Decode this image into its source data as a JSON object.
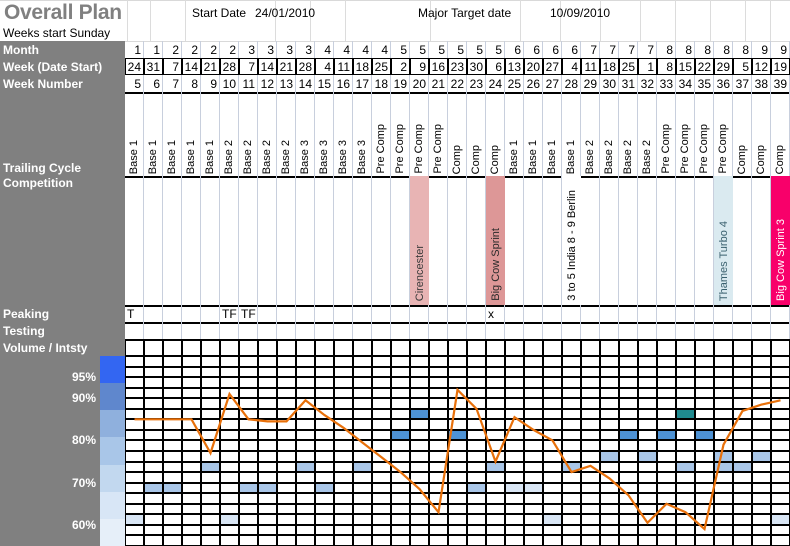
{
  "title": "Overall Plan",
  "subtitle": "Weeks start Sunday",
  "meta": {
    "start_date_label": "Start Date",
    "start_date_value": "24/01/2010",
    "target_date_label": "Major Target date",
    "target_date_value": "10/09/2010"
  },
  "row_labels": {
    "month": "Month",
    "week_date_start": "Week (Date Start)",
    "week_number": "Week Number",
    "training_cycle": "Trailing Cycle",
    "competition": "Competition",
    "peaking": "Peaking",
    "testing": "Testing",
    "volume": "Volume / Intsty"
  },
  "columns": {
    "month": [
      1,
      1,
      2,
      2,
      2,
      2,
      3,
      3,
      3,
      3,
      4,
      4,
      4,
      4,
      5,
      5,
      5,
      5,
      5,
      5,
      6,
      6,
      6,
      6,
      7,
      7,
      7,
      7,
      8,
      8,
      8,
      8,
      8,
      9,
      9,
      9
    ],
    "week_start": [
      24,
      31,
      7,
      14,
      21,
      28,
      7,
      14,
      21,
      28,
      4,
      11,
      18,
      25,
      2,
      9,
      16,
      23,
      30,
      6,
      13,
      20,
      27,
      4,
      11,
      18,
      25,
      1,
      8,
      15,
      22,
      29,
      5,
      12,
      19
    ],
    "week_number": [
      5,
      6,
      7,
      8,
      9,
      10,
      11,
      12,
      13,
      14,
      15,
      16,
      17,
      18,
      19,
      20,
      21,
      22,
      23,
      24,
      25,
      26,
      27,
      28,
      29,
      30,
      31,
      32,
      33,
      34,
      35,
      36,
      37,
      38,
      39
    ],
    "cycle": [
      "Base 1",
      "Base 1",
      "Base 1",
      "Base 1",
      "Base 1",
      "Base 2",
      "Base 2",
      "Base 2",
      "Base 2",
      "Base 3",
      "Base 3",
      "Base 3",
      "Base 3",
      "Pre Comp",
      "Pre Comp",
      "Pre Comp",
      "Pre Comp",
      "Comp",
      "Comp",
      "Comp",
      "Base 1",
      "Base 1",
      "Base 1",
      "Base 1",
      "Base 2",
      "Base 2",
      "Base 2",
      "Base 2",
      "Pre Comp",
      "Pre Comp",
      "Pre Comp",
      "Pre Comp",
      "Comp",
      "Comp",
      "Comp"
    ]
  },
  "competitions": [
    {
      "week": 20,
      "label": "Cirencester",
      "color": "#e8b4b4",
      "text_color": "#3a3a3a"
    },
    {
      "week": 24,
      "label": "Big Cow Sprint",
      "color": "#dd9797",
      "text_color": "#2b2b2b"
    },
    {
      "week": 28,
      "label": "3 to 5 India 8 - 9 Berlin",
      "color": "#ffffff",
      "text_color": "#000000"
    },
    {
      "week": 36,
      "label": "Thames Turbo 4",
      "color": "#daeaf0",
      "text_color": "#39606e"
    },
    {
      "week": 39,
      "label": "Big Cow Sprint 3",
      "color": "#f8006a",
      "text_color": "#ffffff"
    }
  ],
  "peaking_marks": [
    {
      "week": 5,
      "label": "T"
    },
    {
      "week": 10,
      "label": "TF"
    },
    {
      "week": 11,
      "label": "TF"
    },
    {
      "week": 24,
      "label": "x"
    }
  ],
  "testing_marks": [],
  "colors": {
    "header_grey": "#808080",
    "title_grey": "#808080",
    "line": "#e8700a",
    "grid": "#000000",
    "teal_cell": "#1f8a8f"
  },
  "chart_data": {
    "type": "line",
    "title": "Volume / Intsty",
    "xlabel": "",
    "ylabel": "",
    "ytick_labels": [
      "95%",
      "90%",
      "80%",
      "70%",
      "60%"
    ],
    "ytick_values": [
      95,
      90,
      80,
      70,
      60
    ],
    "ylim": [
      55,
      100
    ],
    "y_gridline_values": [
      100,
      97.5,
      95,
      92.5,
      90,
      87.5,
      85,
      82.5,
      80,
      77.5,
      75,
      72.5,
      70,
      67.5,
      65,
      62.5,
      60,
      57.5
    ],
    "legend_swatch_colors": [
      "#3366f2",
      "#5f87cd",
      "#8fb0dd",
      "#a9c6e8",
      "#c2d8ef",
      "#d8e6f6",
      "#e6eff9"
    ],
    "categories": [
      5,
      6,
      7,
      8,
      9,
      10,
      11,
      12,
      13,
      14,
      15,
      16,
      17,
      18,
      19,
      20,
      21,
      22,
      23,
      24,
      25,
      26,
      27,
      28,
      29,
      30,
      31,
      32,
      33,
      34,
      35,
      36,
      37,
      38,
      39
    ],
    "series": [
      {
        "name": "Volume / Intensity",
        "values": [
          85,
          85,
          85,
          85,
          77,
          91,
          85,
          84.5,
          84.5,
          89.5,
          86,
          83,
          79.5,
          76,
          72.5,
          68.5,
          63,
          92,
          87.5,
          75,
          85.5,
          82.5,
          80,
          72.5,
          74,
          71,
          67,
          60.5,
          65,
          63,
          59,
          79,
          87,
          88.5,
          89.5
        ]
      }
    ],
    "highlight_cells": [
      {
        "week": 5,
        "y": 62.5,
        "shade": "light"
      },
      {
        "week": 6,
        "y": 70,
        "shade": "mid"
      },
      {
        "week": 7,
        "y": 70,
        "shade": "mid"
      },
      {
        "week": 9,
        "y": 75,
        "shade": "mid"
      },
      {
        "week": 10,
        "y": 62.5,
        "shade": "light"
      },
      {
        "week": 11,
        "y": 70,
        "shade": "mid"
      },
      {
        "week": 12,
        "y": 70,
        "shade": "mid"
      },
      {
        "week": 14,
        "y": 75,
        "shade": "mid"
      },
      {
        "week": 15,
        "y": 70,
        "shade": "mid"
      },
      {
        "week": 17,
        "y": 75,
        "shade": "mid"
      },
      {
        "week": 19,
        "y": 82.5,
        "shade": "dark"
      },
      {
        "week": 20,
        "y": 87.5,
        "shade": "dark"
      },
      {
        "week": 22,
        "y": 82.5,
        "shade": "dark"
      },
      {
        "week": 23,
        "y": 70,
        "shade": "mid"
      },
      {
        "week": 24,
        "y": 75,
        "shade": "mid"
      },
      {
        "week": 25,
        "y": 70,
        "shade": "light"
      },
      {
        "week": 26,
        "y": 70,
        "shade": "light"
      },
      {
        "week": 27,
        "y": 62.5,
        "shade": "light"
      },
      {
        "week": 28,
        "y": 75,
        "shade": "mid"
      },
      {
        "week": 30,
        "y": 77.5,
        "shade": "mid"
      },
      {
        "week": 31,
        "y": 82.5,
        "shade": "dark"
      },
      {
        "week": 32,
        "y": 77.5,
        "shade": "mid"
      },
      {
        "week": 33,
        "y": 82.5,
        "shade": "dark"
      },
      {
        "week": 34,
        "y": 87.5,
        "shade": "teal"
      },
      {
        "week": 35,
        "y": 82.5,
        "shade": "dark"
      },
      {
        "week": 36,
        "y": 77.5,
        "shade": "mid"
      },
      {
        "week": 36,
        "y": 75,
        "shade": "mid"
      },
      {
        "week": 34,
        "y": 75,
        "shade": "mid"
      },
      {
        "week": 38,
        "y": 77.5,
        "shade": "mid"
      },
      {
        "week": 39,
        "y": 62.5,
        "shade": "light"
      },
      {
        "week": 37,
        "y": 75,
        "shade": "mid"
      }
    ]
  }
}
